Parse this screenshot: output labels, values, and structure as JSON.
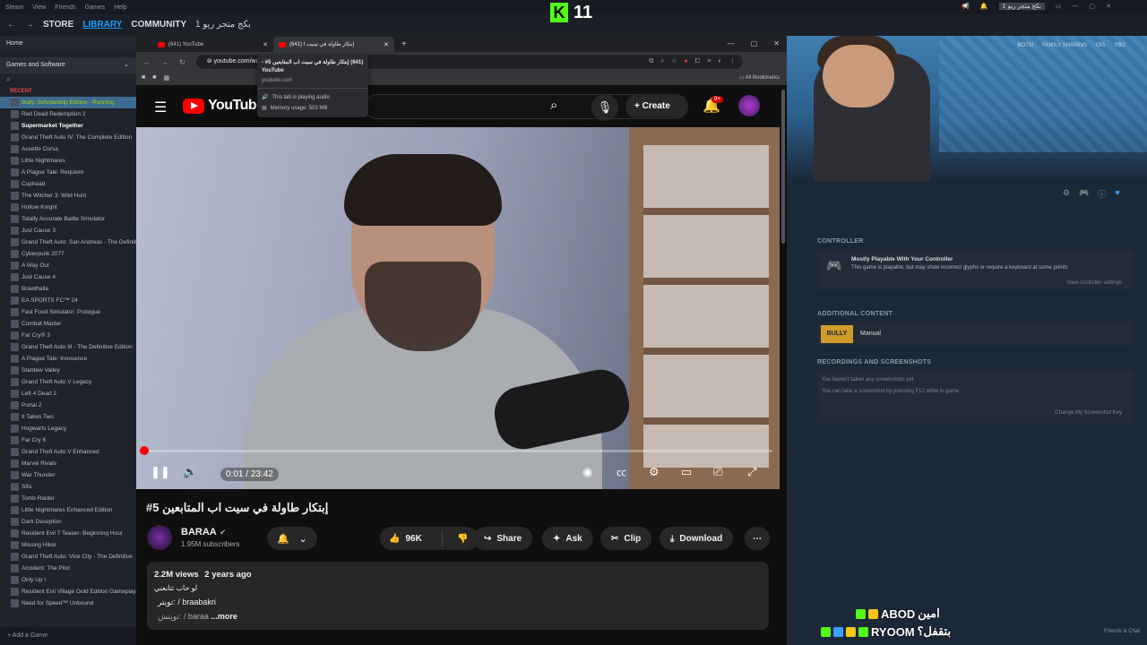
{
  "steam": {
    "menu": [
      "Steam",
      "View",
      "Friends",
      "Games",
      "Help"
    ],
    "nav": {
      "store": "STORE",
      "library": "LIBRARY",
      "community": "COMMUNITY",
      "arabic": "بكج متجر ريو 1"
    },
    "user_badge": "بكج متجر ريو 1",
    "library": {
      "home": "Home",
      "filter": "Games and Software",
      "recent_label": "RECENT",
      "games": [
        {
          "name": "Bully: Scholarship Edition - Running",
          "state": "running"
        },
        {
          "name": "Red Dead Redemption 2",
          "state": ""
        },
        {
          "name": "Supermarket Together",
          "state": "bold"
        },
        {
          "name": "Grand Theft Auto IV: The Complete Edition",
          "state": ""
        },
        {
          "name": "Assetto Corsa",
          "state": ""
        },
        {
          "name": "Little Nightmares",
          "state": ""
        },
        {
          "name": "A Plague Tale: Requiem",
          "state": ""
        },
        {
          "name": "Cuphead",
          "state": ""
        },
        {
          "name": "The Witcher 3: Wild Hunt",
          "state": ""
        },
        {
          "name": "Hollow Knight",
          "state": ""
        },
        {
          "name": "Totally Accurate Battle Simulator",
          "state": ""
        },
        {
          "name": "Just Cause 3",
          "state": ""
        },
        {
          "name": "Grand Theft Auto: San Andreas - The Definitive",
          "state": ""
        },
        {
          "name": "Cyberpunk 2077",
          "state": ""
        },
        {
          "name": "A Way Out",
          "state": ""
        },
        {
          "name": "Just Cause 4",
          "state": ""
        },
        {
          "name": "Brawlhalla",
          "state": ""
        },
        {
          "name": "EA SPORTS FC™ 24",
          "state": ""
        },
        {
          "name": "Fast Food Simulator: Prologue",
          "state": ""
        },
        {
          "name": "Combat Master",
          "state": ""
        },
        {
          "name": "Far Cry® 3",
          "state": ""
        },
        {
          "name": "Grand Theft Auto III - The Definitive Edition",
          "state": ""
        },
        {
          "name": "A Plague Tale: Innocence",
          "state": ""
        },
        {
          "name": "Stardew Valley",
          "state": ""
        },
        {
          "name": "Grand Theft Auto V Legacy",
          "state": ""
        },
        {
          "name": "Left 4 Dead 2",
          "state": ""
        },
        {
          "name": "Portal 2",
          "state": ""
        },
        {
          "name": "It Takes Two",
          "state": ""
        },
        {
          "name": "Hogwarts Legacy",
          "state": ""
        },
        {
          "name": "Far Cry 6",
          "state": ""
        },
        {
          "name": "Grand Theft Auto V Enhanced",
          "state": ""
        },
        {
          "name": "Marvel Rivals",
          "state": ""
        },
        {
          "name": "War Thunder",
          "state": ""
        },
        {
          "name": "Sifu",
          "state": ""
        },
        {
          "name": "Tomb Raider",
          "state": ""
        },
        {
          "name": "Little Nightmares Enhanced Edition",
          "state": ""
        },
        {
          "name": "Dark Deception",
          "state": ""
        },
        {
          "name": "Resident Evil 7 Teaser: Beginning Hour",
          "state": ""
        },
        {
          "name": "Missing Hiker",
          "state": ""
        },
        {
          "name": "Grand Theft Auto: Vice City - The Definitive",
          "state": ""
        },
        {
          "name": "Accident: The Pilot",
          "state": ""
        },
        {
          "name": "Only Up !",
          "state": ""
        },
        {
          "name": "Resident Evil Village Gold Edition Gameplay",
          "state": ""
        },
        {
          "name": "Need for Speed™ Unbound",
          "state": ""
        }
      ],
      "add_game": "Add a Game"
    },
    "right": {
      "hero_links": [
        "BO7SI",
        "FAMILY SHARING",
        "OIS",
        "YBG"
      ],
      "controller_head": "CONTROLLER",
      "controller_title": "Mostly Playable With Your Controller",
      "controller_desc": "This game is playable, but may show incorrect glyphs or require a keyboard at some points",
      "controller_link": "View controller settings",
      "additional_head": "ADDITIONAL CONTENT",
      "manual_thumb": "BULLY",
      "manual": "Manual",
      "recordings_head": "RECORDINGS AND SCREENSHOTS",
      "rec1": "You haven't taken any screenshots yet",
      "rec2": "You can take a screenshot by pressing F12 while in game",
      "rec3": "Change My Screenshot Key",
      "friends_chat": "Friends & Chat"
    }
  },
  "kick": {
    "viewers": "11",
    "badge": "K",
    "chat": [
      {
        "user": "ABOD",
        "message": "امين"
      },
      {
        "user": "RYOOM",
        "message": "بتقفل؟"
      }
    ]
  },
  "chrome": {
    "tabs": [
      {
        "title": "(641) YouTube",
        "active": false
      },
      {
        "title": "(641) إبتكار طاولة في سيت ا",
        "active": true
      }
    ],
    "url": "youtube.com/wat",
    "bookmarks_right": "All Bookmarks",
    "tooltip": {
      "title": "(641) إبتكار طاولة في سيت اب المتابعين 5# - YouTube",
      "url": "youtube.com",
      "audio": "This tab is playing audio",
      "memory": "Memory usage: 503 MB"
    }
  },
  "youtube": {
    "logo": "YouTube",
    "create": "Create",
    "notifications": "9+",
    "video": {
      "current_time": "0:01",
      "duration": "23:42",
      "progress": 0.0007
    },
    "title": "إبتكار طاولة في سيت اب المتابعين 5#",
    "channel": "BARAA",
    "subscribers": "1.95M subscribers",
    "likes": "96K",
    "share": "Share",
    "ask": "Ask",
    "clip": "Clip",
    "download": "Download",
    "description": {
      "views": "2.2M views",
      "age": "2 years ago",
      "line1": "لو حاب تتابعني",
      "line2": "تويتر:  / braabakri",
      "line3": "تويتش:  / baraa",
      "more": "...more"
    }
  }
}
